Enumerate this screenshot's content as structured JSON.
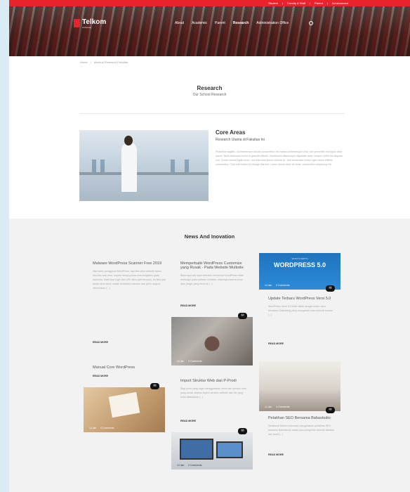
{
  "topbar": {
    "links": [
      "Student",
      "Faculty & Staff",
      "Parent",
      "Achievement"
    ]
  },
  "header": {
    "logo_text": "Telkom",
    "logo_sub": "University",
    "nav": [
      "About",
      "Academic",
      "Parent",
      "Research",
      "Administration Office"
    ],
    "active_nav": "Research"
  },
  "breadcrumb": {
    "home": "Home",
    "separator": "/",
    "current": "Mockup Research Fakultas"
  },
  "section": {
    "title": "Research",
    "subtitle": "Our School Research"
  },
  "core": {
    "title": "Core Areas",
    "subtitle": "Research Utama di Fakultas Ini",
    "text": "Phasellus sagittis, dui elementum iaculis consectetur, est massa pellentesque urna, non venenatis nisl ligula vitae ipsum. Nulla bibendum tortor at gravida efficitur. Vestibulum ullamcorper dignissim ante, tempor mollis est aliquam non. Donec blandit ligula lacus, non interdum ipsum ultrices ac. Sed accumsan metus eget metus efficitur consectetur. Click edit button to change this text. Lorem ipsum dolor sit amet, consectetur adipiscing elit."
  },
  "news": {
    "title": "News And Inovation",
    "read_more": "READ MORE",
    "posts": [
      {
        "title": "Malware WordPress Scanner Free 2019",
        "body": "Jika kamu pengguna WordPress, tapi kita situs website kamu, tiba-tiba ada error, seperti tampil pesan mencurigakan pada halaman, tidak bisa login dan URL situs jadi berubah, itu bisa jadi tanda situs kamu sudah terinfeksi malware dan perlu segera dibersihkan (...)"
      },
      {
        "title": "Manual Core WordPress",
        "body": ""
      },
      {
        "title": "Memperbaiki WordPress Customize yang Rusak - Pada Website Multisite",
        "body": "Beberapa kali saya temukan customize WordPress tidak berfungsi pada website multisite, biasanya karena tema atau plugin yang bentrok (...)"
      },
      {
        "title": "Import Struktur Web dan P-Prodi",
        "body": "Bagi prodi yang ingin menggunakan tema dan struktur web yang sama, silakan import struktur website dari file yang telah disediakan (...)"
      },
      {
        "title": "Update Terbaru WordPress Versi 5.0",
        "body": "WordPress Versi 5.0 telah dirilis dengan editor baru bernama Gutenberg yang mengubah cara menulis konten (...)"
      },
      {
        "title": "Pelatihan SEO Bersama Babastudio",
        "body": "Direktorat Sistem Informasi mengadakan pelatihan SEO bersama Babastudio untuk para pengelola website fakultas dan prodi (...)"
      }
    ],
    "thumbs": {
      "wp": {
        "small": "WHAT'S NEW IN",
        "big": "WORDPRESS 5.0",
        "date": "14 Jan",
        "comments": "0 Comments"
      },
      "desk": {
        "date": "14 Jan",
        "comments": "0 Comments"
      },
      "note": {
        "date": "14 Jan",
        "comments": "0 Comments"
      },
      "class": {
        "date": "14 Jan",
        "comments": "0 Comments"
      },
      "laptop": {
        "date": "14 Jan",
        "comments": "0 Comments"
      }
    },
    "badge_glyph": "✉"
  }
}
